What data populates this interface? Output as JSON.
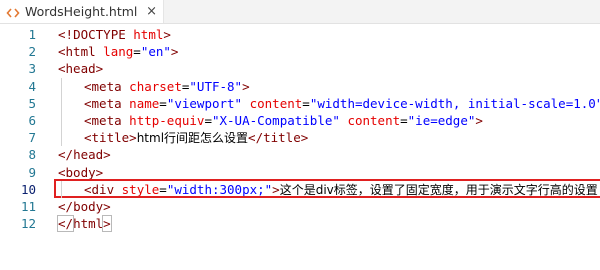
{
  "tab": {
    "icon": "code-angle-brackets-icon",
    "title": "WordsHeight.html",
    "close": "×"
  },
  "colors": {
    "tag": "#800000",
    "attribute": "#e50000",
    "value": "#0000ff",
    "line_number": "#237893",
    "highlight_box": "#e02020"
  },
  "lines": [
    {
      "n": "1"
    },
    {
      "n": "2"
    },
    {
      "n": "3"
    },
    {
      "n": "4"
    },
    {
      "n": "5"
    },
    {
      "n": "6"
    },
    {
      "n": "7"
    },
    {
      "n": "8"
    },
    {
      "n": "9"
    },
    {
      "n": "10"
    },
    {
      "n": "11"
    },
    {
      "n": "12"
    }
  ],
  "code": {
    "l1": {
      "open": "<!",
      "tag": "DOCTYPE",
      "sp": " ",
      "attr": "html",
      "close": ">"
    },
    "l2": {
      "open": "<",
      "tag": "html",
      "sp": " ",
      "attr": "lang",
      "eq": "=",
      "val": "\"en\"",
      "close": ">"
    },
    "l3": {
      "open": "<",
      "tag": "head",
      "close": ">"
    },
    "l4": {
      "open": "<",
      "tag": "meta",
      "sp": " ",
      "attr": "charset",
      "eq": "=",
      "val": "\"UTF-8\"",
      "close": ">"
    },
    "l5": {
      "open": "<",
      "tag": "meta",
      "sp": " ",
      "attr": "name",
      "eq": "=",
      "val": "\"viewport\"",
      "sp2": " ",
      "attr2": "content",
      "eq2": "=",
      "val2": "\"width=device-width, initial-scale=1.0\"",
      "close": ">"
    },
    "l6": {
      "open": "<",
      "tag": "meta",
      "sp": " ",
      "attr": "http-equiv",
      "eq": "=",
      "val": "\"X-UA-Compatible\"",
      "sp2": " ",
      "attr2": "content",
      "eq2": "=",
      "val2": "\"ie=edge\"",
      "close": ">"
    },
    "l7": {
      "open": "<",
      "tag": "title",
      "close": ">",
      "text": "html行间距怎么设置",
      "endopen": "</",
      "endtag": "title",
      "endclose": ">"
    },
    "l8": {
      "open": "</",
      "tag": "head",
      "close": ">"
    },
    "l9": {
      "open": "<",
      "tag": "body",
      "close": ">"
    },
    "l10": {
      "open": "<",
      "tag": "div",
      "sp": " ",
      "attr": "style",
      "eq": "=",
      "val": "\"width:300px;\"",
      "close": ">",
      "text": "这个是div标签，设置了固定宽度，用于演示文字行高的设置"
    },
    "l11": {
      "open": "</",
      "tag": "body",
      "close": ">"
    },
    "l12": {
      "open": "</",
      "tag": "html",
      "close": ">"
    }
  }
}
